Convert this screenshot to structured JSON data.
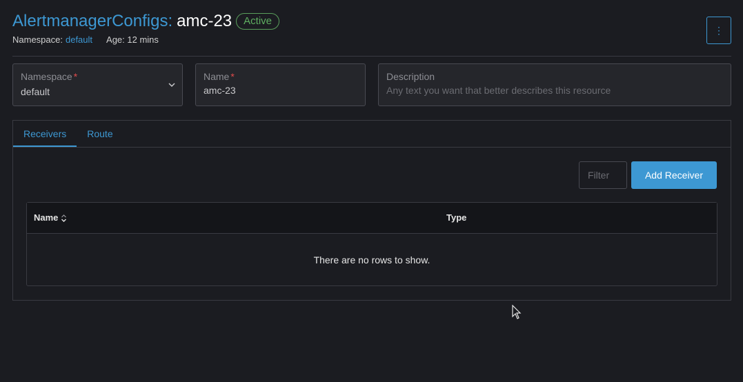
{
  "header": {
    "resource_type": "AlertmanagerConfigs:",
    "name": "amc-23",
    "status": "Active",
    "namespace_label": "Namespace:",
    "namespace_value": "default",
    "age": "Age: 12 mins",
    "menu_icon": "⋮"
  },
  "form": {
    "namespace": {
      "label": "Namespace",
      "required_mark": "*",
      "value": "default"
    },
    "name": {
      "label": "Name",
      "required_mark": "*",
      "value": "amc-23"
    },
    "description": {
      "label": "Description",
      "placeholder": "Any text you want that better describes this resource"
    }
  },
  "tabs": [
    {
      "label": "Receivers",
      "active": true
    },
    {
      "label": "Route",
      "active": false
    }
  ],
  "receivers": {
    "filter_placeholder": "Filter",
    "add_label": "Add Receiver",
    "columns": [
      "Name",
      "Type"
    ],
    "empty_text": "There are no rows to show."
  },
  "colors": {
    "accent": "#3d98d3",
    "success": "#5fae61",
    "background": "#1b1c21",
    "required": "#e24c4c"
  },
  "icons": {
    "menu": "kebab-icon",
    "select": "chevron-down-icon",
    "sort": "sort-icon",
    "pointer": "cursor-icon"
  }
}
